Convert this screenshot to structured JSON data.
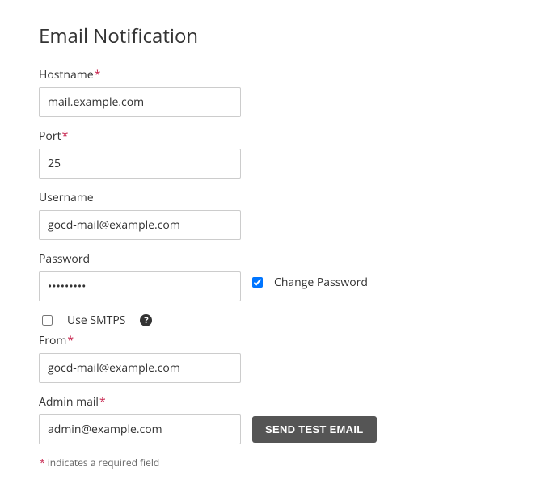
{
  "title": "Email Notification",
  "required_marker": "*",
  "fields": {
    "hostname": {
      "label": "Hostname",
      "value": "mail.example.com",
      "required": true
    },
    "port": {
      "label": "Port",
      "value": "25",
      "required": true
    },
    "username": {
      "label": "Username",
      "value": "gocd-mail@example.com",
      "required": false
    },
    "password": {
      "label": "Password",
      "value": "•••••••••",
      "required": false
    },
    "change_password": {
      "label": "Change Password",
      "checked": true
    },
    "use_smtps": {
      "label": "Use SMTPS",
      "checked": false
    },
    "from": {
      "label": "From",
      "value": "gocd-mail@example.com",
      "required": true
    },
    "admin_mail": {
      "label": "Admin mail",
      "value": "admin@example.com",
      "required": true
    }
  },
  "buttons": {
    "send_test": "SEND TEST EMAIL"
  },
  "footnote": "indicates a required field"
}
